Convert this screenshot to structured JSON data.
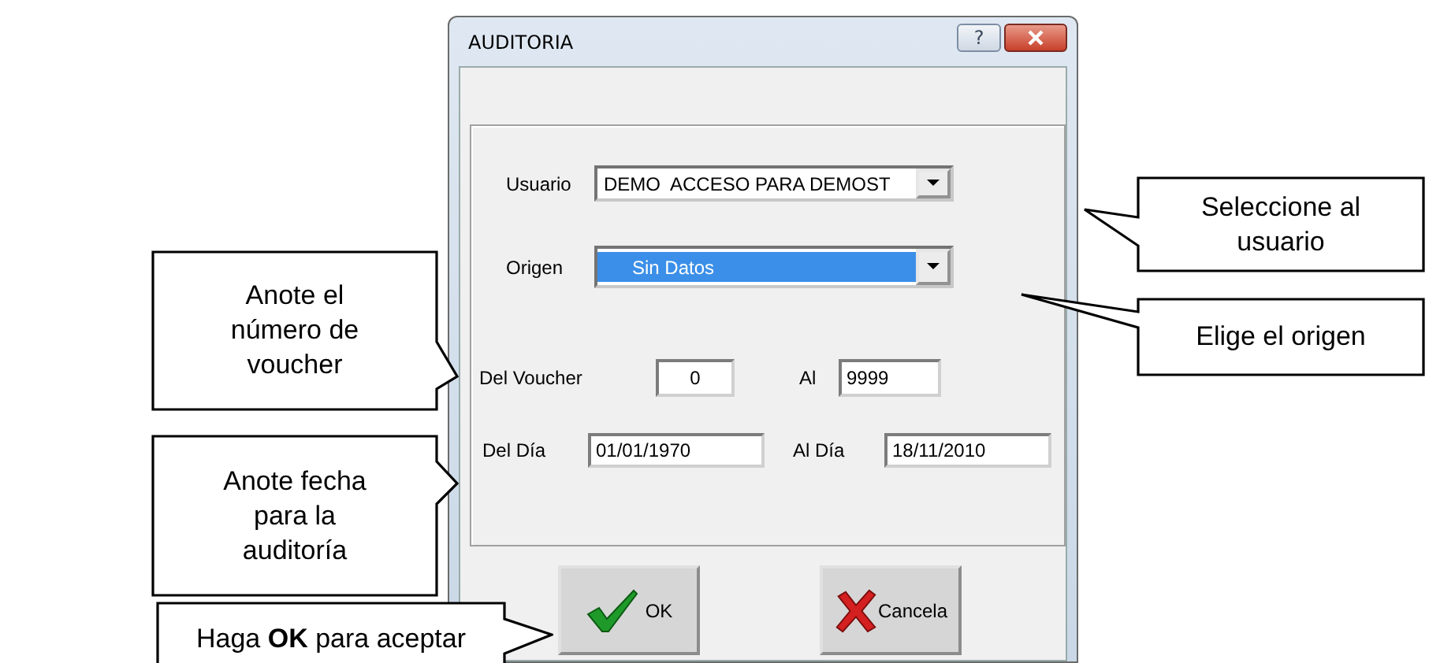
{
  "window": {
    "title": "AUDITORIA",
    "help_button": "?"
  },
  "usuario": {
    "label": "Usuario",
    "value": "DEMO  ACCESO PARA DEMOST"
  },
  "origen": {
    "label": "Origen",
    "value": "Sin Datos",
    "highlighted": true
  },
  "voucher": {
    "from_label": "Del Voucher",
    "from": "0",
    "to_label": "Al",
    "to": "9999"
  },
  "dates": {
    "from_label": "Del Día",
    "from": "01/01/1970",
    "to_label": "Al Día",
    "to": "18/11/2010"
  },
  "buttons": [
    {
      "kind": "ok",
      "label": "OK"
    },
    {
      "kind": "cancel",
      "label": "Cancela"
    }
  ],
  "callouts": [
    {
      "text": "Seleccione al usuario"
    },
    {
      "text": "Elige el origen"
    },
    {
      "text": "Anote el número de voucher"
    },
    {
      "text": "Anote fecha para la auditoría"
    },
    {
      "text": "Haga **OK** para aceptar"
    }
  ]
}
